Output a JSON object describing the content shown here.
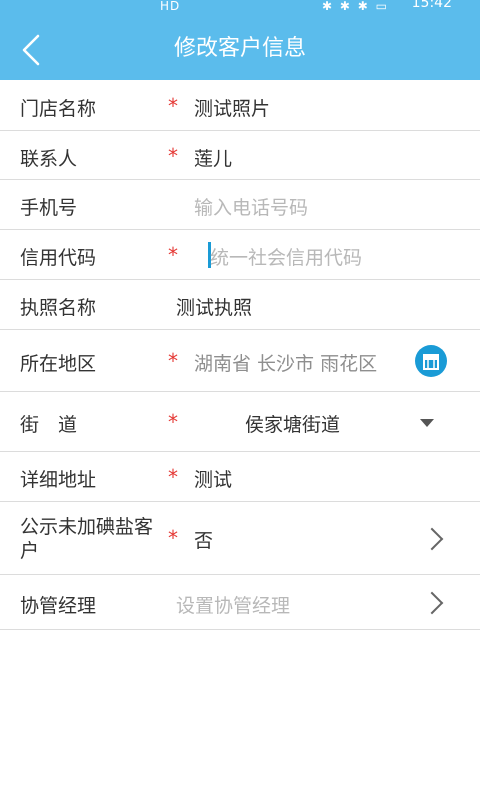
{
  "status_bar": {
    "left_text": "HD",
    "time": "15:42"
  },
  "header": {
    "title": "修改客户信息",
    "back_icon": "chevron-left-icon"
  },
  "form": {
    "rows": [
      {
        "label": "门店名称",
        "required": true,
        "value": "测试照片"
      },
      {
        "label": "联系人",
        "required": true,
        "value": "莲儿"
      },
      {
        "label": "手机号",
        "required": false,
        "placeholder": "输入电话号码"
      },
      {
        "label": "信用代码",
        "required": true,
        "placeholder": "统一社会信用代码"
      },
      {
        "label": "执照名称",
        "required": false,
        "value": "测试执照"
      },
      {
        "label": "所在地区",
        "required": true,
        "value": "湖南省 长沙市 雨花区"
      },
      {
        "label": "街　道",
        "required": true,
        "value": "侯家塘街道"
      },
      {
        "label": "详细地址",
        "required": true,
        "value": "测试"
      },
      {
        "label": "公示未加碘盐客户",
        "required": true,
        "value": "否"
      },
      {
        "label": "协管经理",
        "required": false,
        "placeholder": "设置协管经理"
      }
    ]
  },
  "star": "*",
  "colors": {
    "accent": "#5bbcec",
    "required_star": "#e53935",
    "placeholder": "#b8b8b8",
    "map_button": "#1a9bd6"
  }
}
